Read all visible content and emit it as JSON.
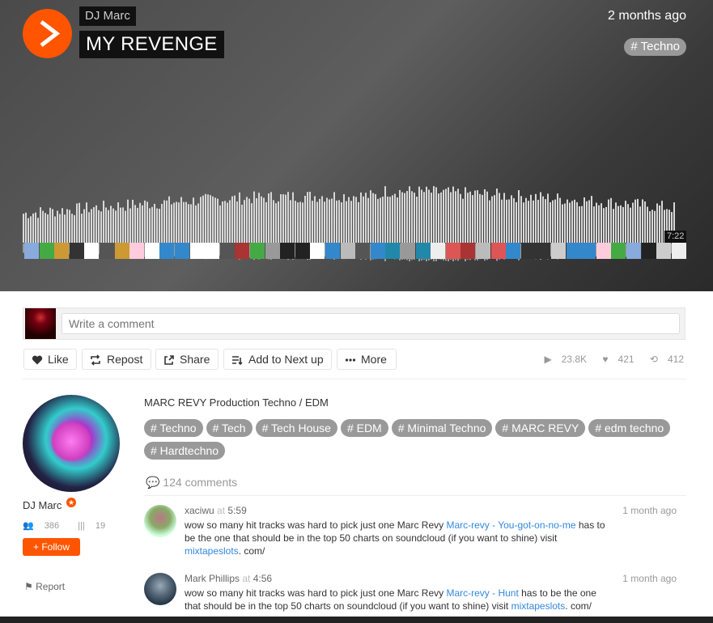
{
  "header": {
    "artist": "DJ Marc",
    "track": "MY REVENGE",
    "posted": "2 months ago",
    "genre": "# Techno",
    "duration": "7:22"
  },
  "comment_box": {
    "placeholder": "Write a comment"
  },
  "actions": {
    "like": "Like",
    "repost": "Repost",
    "share": "Share",
    "next_up": "Add to Next up",
    "more": "More"
  },
  "stats": {
    "plays": "23.8K",
    "likes": "421",
    "reposts": "412"
  },
  "user": {
    "name": "DJ Marc",
    "followers": "386",
    "tracks": "19",
    "follow": "Follow",
    "report": "Report"
  },
  "description": "MARC REVY Production Techno / EDM",
  "tags": [
    "# Techno",
    "# Tech",
    "# Tech House",
    "# EDM",
    "# Minimal Techno",
    "# MARC REVY",
    "# edm techno",
    "# Hardtechno"
  ],
  "comments_count": "124 comments",
  "comments": [
    {
      "user": "xaciwu",
      "at": "at",
      "ts": "5:59",
      "time": "1 month ago",
      "text_a": "wow so many hit tracks was hard to pick just one Marc Revy ",
      "link1": "Marc-revy - You-got-on-no-me",
      "text_b": " has to be the one that should be in the top 50 charts on soundcloud (if you want to shine) visit ",
      "link2": "mixtapeslots",
      "text_c": ". com/"
    },
    {
      "user": "Mark Phillips",
      "at": "at",
      "ts": "4:56",
      "time": "1 month ago",
      "text_a": "wow so many hit tracks was hard to pick just one Marc Revy ",
      "link1": "Marc-revy - Hunt",
      "text_b": " has to be the one that should be in the top 50 charts on soundcloud (if you want to shine) visit ",
      "link2": "mixtapeslots",
      "text_c": ". com/"
    }
  ],
  "colors": {
    "accent": "#ff5500",
    "tag_bg": "#999999",
    "link": "#3388dd"
  }
}
